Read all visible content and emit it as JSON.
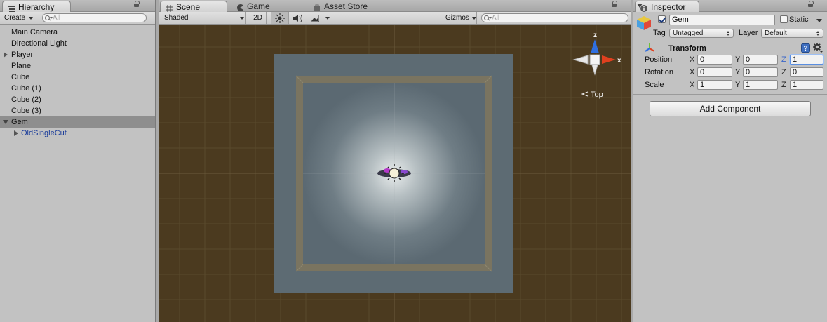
{
  "hierarchy": {
    "tab": "Hierarchy",
    "create": "Create",
    "search_placeholder": "All",
    "items": [
      {
        "label": "Main Camera"
      },
      {
        "label": "Directional Light"
      },
      {
        "label": "Player"
      },
      {
        "label": "Plane"
      },
      {
        "label": "Cube"
      },
      {
        "label": "Cube (1)"
      },
      {
        "label": "Cube (2)"
      },
      {
        "label": "Cube (3)"
      },
      {
        "label": "Gem"
      },
      {
        "label": "OldSingleCut"
      }
    ]
  },
  "scene": {
    "tabs": {
      "scene": "Scene",
      "game": "Game",
      "asset_store": "Asset Store"
    },
    "shading": "Shaded",
    "mode2d": "2D",
    "gizmos": "Gizmos",
    "search_placeholder": "All",
    "gizmo": {
      "z": "z",
      "x": "x",
      "view": "Top"
    }
  },
  "inspector": {
    "tab": "Inspector",
    "object_name": "Gem",
    "static_label": "Static",
    "tag_label": "Tag",
    "tag_value": "Untagged",
    "layer_label": "Layer",
    "layer_value": "Default",
    "transform": {
      "title": "Transform",
      "position": {
        "label": "Position",
        "x": "0",
        "y": "0",
        "z": "1"
      },
      "rotation": {
        "label": "Rotation",
        "x": "0",
        "y": "0",
        "z": "0"
      },
      "scale": {
        "label": "Scale",
        "x": "1",
        "y": "1",
        "z": "1"
      }
    },
    "add_component": "Add Component"
  },
  "axis": {
    "x": "X",
    "y": "Y",
    "z": "Z"
  },
  "colors": {
    "ground": "#4b3a1f",
    "floor": "#5d6b73",
    "axis_y_green": "#6fbf3a",
    "axis_z_blue": "#2f6fe0",
    "axis_x_red": "#e0401f"
  }
}
